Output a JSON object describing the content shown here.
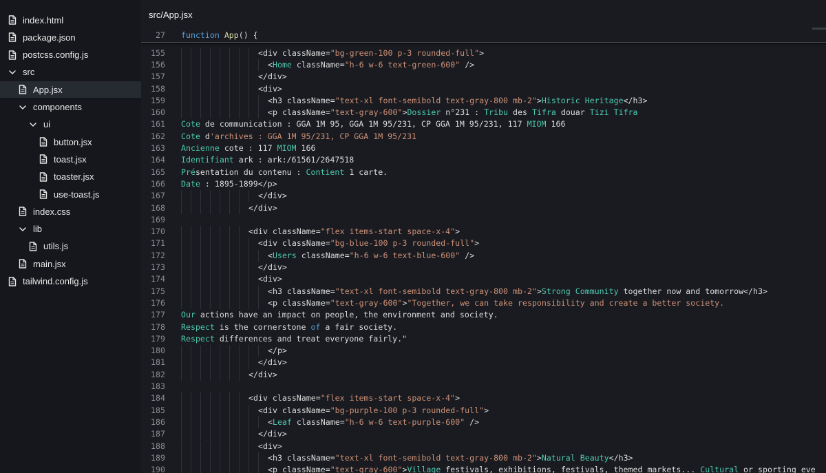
{
  "sidebar": {
    "items": [
      {
        "label": "index.html",
        "icon": "file-icon",
        "indent": 0,
        "kind": "file"
      },
      {
        "label": "package.json",
        "icon": "file-icon",
        "indent": 0,
        "kind": "file"
      },
      {
        "label": "postcss.config.js",
        "icon": "file-icon",
        "indent": 0,
        "kind": "file"
      },
      {
        "label": "src",
        "icon": "chevron-down-icon",
        "indent": 0,
        "kind": "folder"
      },
      {
        "label": "App.jsx",
        "icon": "file-icon",
        "indent": 1,
        "kind": "file",
        "active": true
      },
      {
        "label": "components",
        "icon": "chevron-down-icon",
        "indent": 1,
        "kind": "folder"
      },
      {
        "label": "ui",
        "icon": "chevron-down-icon",
        "indent": 2,
        "kind": "folder"
      },
      {
        "label": "button.jsx",
        "icon": "file-icon",
        "indent": 3,
        "kind": "file"
      },
      {
        "label": "toast.jsx",
        "icon": "file-icon",
        "indent": 3,
        "kind": "file"
      },
      {
        "label": "toaster.jsx",
        "icon": "file-icon",
        "indent": 3,
        "kind": "file"
      },
      {
        "label": "use-toast.js",
        "icon": "file-icon",
        "indent": 3,
        "kind": "file"
      },
      {
        "label": "index.css",
        "icon": "file-icon",
        "indent": 1,
        "kind": "file"
      },
      {
        "label": "lib",
        "icon": "chevron-down-icon",
        "indent": 1,
        "kind": "folder"
      },
      {
        "label": "utils.js",
        "icon": "file-icon",
        "indent": 2,
        "kind": "file"
      },
      {
        "label": "main.jsx",
        "icon": "file-icon",
        "indent": 1,
        "kind": "file"
      },
      {
        "label": "tailwind.config.js",
        "icon": "file-icon",
        "indent": 0,
        "kind": "file"
      }
    ]
  },
  "editor": {
    "tab_title": "src/App.jsx",
    "sticky": {
      "num": "27",
      "tokens": [
        [
          "k",
          "function "
        ],
        [
          "f",
          "App"
        ],
        [
          "p",
          "() {"
        ]
      ]
    },
    "lines": [
      {
        "num": "155",
        "indent": 8,
        "tokens": [
          [
            "p",
            "<div className="
          ],
          [
            "s",
            "\"bg-green-100 p-3 rounded-full\""
          ],
          [
            "p",
            ">"
          ]
        ]
      },
      {
        "num": "156",
        "indent": 9,
        "tokens": [
          [
            "p",
            "<"
          ],
          [
            "c",
            "Home"
          ],
          [
            "p",
            " className="
          ],
          [
            "s",
            "\"h-6 w-6 text-green-600\""
          ],
          [
            "p",
            " />"
          ]
        ]
      },
      {
        "num": "157",
        "indent": 8,
        "tokens": [
          [
            "p",
            "</div>"
          ]
        ]
      },
      {
        "num": "158",
        "indent": 8,
        "tokens": [
          [
            "p",
            "<div>"
          ]
        ]
      },
      {
        "num": "159",
        "indent": 9,
        "tokens": [
          [
            "p",
            "<h3 className="
          ],
          [
            "s",
            "\"text-xl font-semibold text-gray-800 mb-2\""
          ],
          [
            "p",
            ">"
          ],
          [
            "c",
            "Historic Heritage"
          ],
          [
            "p",
            "</h3>"
          ]
        ]
      },
      {
        "num": "160",
        "indent": 9,
        "tokens": [
          [
            "p",
            "<p className="
          ],
          [
            "s",
            "\"text-gray-600\""
          ],
          [
            "p",
            ">"
          ],
          [
            "c",
            "Dossier"
          ],
          [
            "p",
            " n°231 : "
          ],
          [
            "c",
            "Tribu"
          ],
          [
            "p",
            " des "
          ],
          [
            "c",
            "Tifra"
          ],
          [
            "p",
            " douar "
          ],
          [
            "c",
            "Tizi Tifra"
          ]
        ]
      },
      {
        "num": "161",
        "indent": 0,
        "tokens": [
          [
            "c",
            "Cote"
          ],
          [
            "p",
            " de communication : GGA 1M 95, GGA 1M 95/231, CP GGA 1M 95/231, 117 "
          ],
          [
            "c",
            "MIOM"
          ],
          [
            "p",
            " 166"
          ]
        ]
      },
      {
        "num": "162",
        "indent": 0,
        "tokens": [
          [
            "c",
            "Cote"
          ],
          [
            "p",
            " d"
          ],
          [
            "s",
            "'archives : GGA 1M 95/231, CP GGA 1M 95/231"
          ]
        ]
      },
      {
        "num": "163",
        "indent": 0,
        "tokens": [
          [
            "c",
            "Ancienne"
          ],
          [
            "p",
            " cote : 117 "
          ],
          [
            "c",
            "MIOM"
          ],
          [
            "p",
            " 166"
          ]
        ]
      },
      {
        "num": "164",
        "indent": 0,
        "tokens": [
          [
            "c",
            "Identifiant"
          ],
          [
            "p",
            " ark : ark:/61561/2647518"
          ]
        ]
      },
      {
        "num": "165",
        "indent": 0,
        "tokens": [
          [
            "c",
            "Pré"
          ],
          [
            "p",
            "sentation du contenu : "
          ],
          [
            "c",
            "Contient"
          ],
          [
            "p",
            " 1 carte."
          ]
        ]
      },
      {
        "num": "166",
        "indent": 0,
        "tokens": [
          [
            "c",
            "Date"
          ],
          [
            "p",
            " : 1895-1899</p>"
          ]
        ]
      },
      {
        "num": "167",
        "indent": 8,
        "tokens": [
          [
            "p",
            "</div>"
          ]
        ]
      },
      {
        "num": "168",
        "indent": 7,
        "tokens": [
          [
            "p",
            "</div>"
          ]
        ]
      },
      {
        "num": "169",
        "indent": 0,
        "tokens": []
      },
      {
        "num": "170",
        "indent": 7,
        "tokens": [
          [
            "p",
            "<div className="
          ],
          [
            "s",
            "\"flex items-start space-x-4\""
          ],
          [
            "p",
            ">"
          ]
        ]
      },
      {
        "num": "171",
        "indent": 8,
        "tokens": [
          [
            "p",
            "<div className="
          ],
          [
            "s",
            "\"bg-blue-100 p-3 rounded-full\""
          ],
          [
            "p",
            ">"
          ]
        ]
      },
      {
        "num": "172",
        "indent": 9,
        "tokens": [
          [
            "p",
            "<"
          ],
          [
            "c",
            "Users"
          ],
          [
            "p",
            " className="
          ],
          [
            "s",
            "\"h-6 w-6 text-blue-600\""
          ],
          [
            "p",
            " />"
          ]
        ]
      },
      {
        "num": "173",
        "indent": 8,
        "tokens": [
          [
            "p",
            "</div>"
          ]
        ]
      },
      {
        "num": "174",
        "indent": 8,
        "tokens": [
          [
            "p",
            "<div>"
          ]
        ]
      },
      {
        "num": "175",
        "indent": 9,
        "tokens": [
          [
            "p",
            "<h3 className="
          ],
          [
            "s",
            "\"text-xl font-semibold text-gray-800 mb-2\""
          ],
          [
            "p",
            ">"
          ],
          [
            "c",
            "Strong Community"
          ],
          [
            "p",
            " together now and tomorrow</h3>"
          ]
        ]
      },
      {
        "num": "176",
        "indent": 9,
        "tokens": [
          [
            "p",
            "<p className="
          ],
          [
            "s",
            "\"text-gray-600\""
          ],
          [
            "p",
            ">"
          ],
          [
            "s",
            "\"Together, we can take responsibility and create a better society."
          ]
        ]
      },
      {
        "num": "177",
        "indent": 0,
        "tokens": [
          [
            "c",
            "Our"
          ],
          [
            "p",
            " actions have an impact on people, the environment and society."
          ]
        ]
      },
      {
        "num": "178",
        "indent": 0,
        "tokens": [
          [
            "c",
            "Respect"
          ],
          [
            "p",
            " is the cornerstone "
          ],
          [
            "k",
            "of"
          ],
          [
            "p",
            " a fair society."
          ]
        ]
      },
      {
        "num": "179",
        "indent": 0,
        "tokens": [
          [
            "c",
            "Respect"
          ],
          [
            "p",
            " differences and treat everyone fairly.\""
          ]
        ]
      },
      {
        "num": "180",
        "indent": 9,
        "tokens": [
          [
            "p",
            "</p>"
          ]
        ]
      },
      {
        "num": "181",
        "indent": 8,
        "tokens": [
          [
            "p",
            "</div>"
          ]
        ]
      },
      {
        "num": "182",
        "indent": 7,
        "tokens": [
          [
            "p",
            "</div>"
          ]
        ]
      },
      {
        "num": "183",
        "indent": 0,
        "tokens": []
      },
      {
        "num": "184",
        "indent": 7,
        "tokens": [
          [
            "p",
            "<div className="
          ],
          [
            "s",
            "\"flex items-start space-x-4\""
          ],
          [
            "p",
            ">"
          ]
        ]
      },
      {
        "num": "185",
        "indent": 8,
        "tokens": [
          [
            "p",
            "<div className="
          ],
          [
            "s",
            "\"bg-purple-100 p-3 rounded-full\""
          ],
          [
            "p",
            ">"
          ]
        ]
      },
      {
        "num": "186",
        "indent": 9,
        "tokens": [
          [
            "p",
            "<"
          ],
          [
            "c",
            "Leaf"
          ],
          [
            "p",
            " className="
          ],
          [
            "s",
            "\"h-6 w-6 text-purple-600\""
          ],
          [
            "p",
            " />"
          ]
        ]
      },
      {
        "num": "187",
        "indent": 8,
        "tokens": [
          [
            "p",
            "</div>"
          ]
        ]
      },
      {
        "num": "188",
        "indent": 8,
        "tokens": [
          [
            "p",
            "<div>"
          ]
        ]
      },
      {
        "num": "189",
        "indent": 9,
        "tokens": [
          [
            "p",
            "<h3 className="
          ],
          [
            "s",
            "\"text-xl font-semibold text-gray-800 mb-2\""
          ],
          [
            "p",
            ">"
          ],
          [
            "c",
            "Natural Beauty"
          ],
          [
            "p",
            "</h3>"
          ]
        ]
      },
      {
        "num": "190",
        "indent": 9,
        "tokens": [
          [
            "p",
            "<p className="
          ],
          [
            "s",
            "\"text-gray-600\""
          ],
          [
            "p",
            ">"
          ],
          [
            "c",
            "Village"
          ],
          [
            "p",
            " festivals, exhibitions, festivals, themed markets... "
          ],
          [
            "c",
            "Cultural"
          ],
          [
            "p",
            " or sporting eve"
          ]
        ]
      }
    ]
  },
  "colors": {
    "background": "#15171c",
    "editor_background": "#191b20",
    "active_item": "#262a31",
    "keyword": "#569cd6",
    "function": "#dcdcaa",
    "string": "#ce9178",
    "component": "#4ec9b0",
    "text": "#dcdcdc",
    "line_number": "#8d8f96"
  }
}
